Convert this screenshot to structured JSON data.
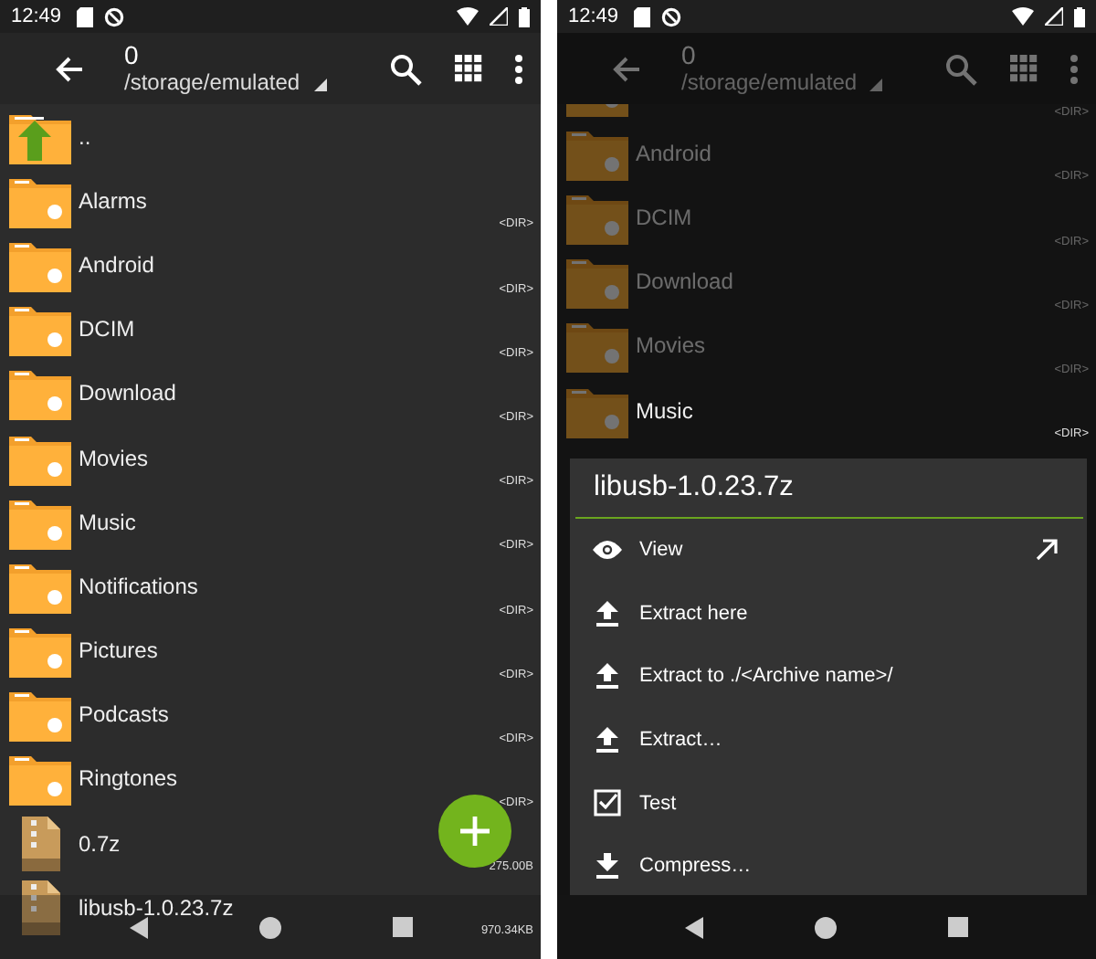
{
  "screens": [
    {
      "status_bar": {
        "time": "12:49"
      },
      "toolbar": {
        "title": "0",
        "path": "/storage/emulated"
      },
      "dimmed": false,
      "fab": true,
      "files": [
        {
          "kind": "up",
          "name": ".."
        },
        {
          "kind": "folder",
          "name": "Alarms",
          "size": "<DIR>"
        },
        {
          "kind": "folder",
          "name": "Android",
          "size": "<DIR>"
        },
        {
          "kind": "folder",
          "name": "DCIM",
          "size": "<DIR>"
        },
        {
          "kind": "folder",
          "name": "Download",
          "size": "<DIR>"
        },
        {
          "kind": "folder",
          "name": "Movies",
          "size": "<DIR>"
        },
        {
          "kind": "folder",
          "name": "Music",
          "size": "<DIR>"
        },
        {
          "kind": "folder",
          "name": "Notifications",
          "size": "<DIR>"
        },
        {
          "kind": "folder",
          "name": "Pictures",
          "size": "<DIR>"
        },
        {
          "kind": "folder",
          "name": "Podcasts",
          "size": "<DIR>"
        },
        {
          "kind": "folder",
          "name": "Ringtones",
          "size": "<DIR>"
        },
        {
          "kind": "archive",
          "name": "0.7z",
          "size": "275.00B"
        },
        {
          "kind": "archive",
          "name": "libusb-1.0.23.7z",
          "size": "970.34KB"
        }
      ]
    },
    {
      "status_bar": {
        "time": "12:49"
      },
      "toolbar": {
        "title": "0",
        "path": "/storage/emulated"
      },
      "dimmed": true,
      "fab": false,
      "files": [
        {
          "kind": "folder",
          "size": "<DIR>"
        },
        {
          "kind": "folder",
          "name": "Android",
          "size": "<DIR>"
        },
        {
          "kind": "folder",
          "name": "DCIM",
          "size": "<DIR>"
        },
        {
          "kind": "folder",
          "name": "Download",
          "size": "<DIR>"
        },
        {
          "kind": "folder",
          "name": "Movies",
          "size": "<DIR>"
        },
        {
          "kind": "folder",
          "name": "Music",
          "size": "<DIR>"
        }
      ],
      "dialog": {
        "title": "libusb-1.0.23.7z",
        "items": [
          {
            "kind": "view",
            "label": "View"
          },
          {
            "kind": "extract",
            "label": "Extract here"
          },
          {
            "kind": "extract",
            "label": "Extract to ./<Archive name>/"
          },
          {
            "kind": "extract",
            "label": "Extract…"
          },
          {
            "kind": "test",
            "label": "Test"
          },
          {
            "kind": "compress",
            "label": "Compress…"
          }
        ]
      }
    }
  ]
}
